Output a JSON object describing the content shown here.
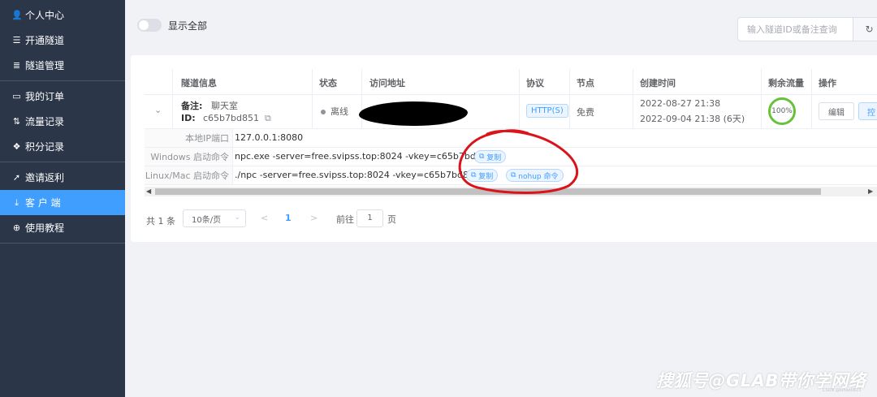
{
  "sidebar": {
    "groups": [
      [
        {
          "label": "个人中心",
          "icon": "user-icon",
          "glyph": "👤"
        },
        {
          "label": "开通隧道",
          "icon": "server-icon",
          "glyph": "☰"
        },
        {
          "label": "隧道管理",
          "icon": "list-icon",
          "glyph": "≣"
        }
      ],
      [
        {
          "label": "我的订单",
          "icon": "card-icon",
          "glyph": "▭"
        },
        {
          "label": "流量记录",
          "icon": "sort-icon",
          "glyph": "⇅"
        },
        {
          "label": "积分记录",
          "icon": "gift-icon",
          "glyph": "❖"
        }
      ],
      [
        {
          "label": "邀请返利",
          "icon": "share-icon",
          "glyph": "➚"
        },
        {
          "label": "客 户 端",
          "icon": "download-icon",
          "glyph": "⤓",
          "active": true
        },
        {
          "label": "使用教程",
          "icon": "zoom-icon",
          "glyph": "⊕"
        }
      ]
    ]
  },
  "topbar": {
    "toggle_label": "显示全部",
    "search_placeholder": "输入隧道ID或备注查询",
    "refresh_glyph": "↻"
  },
  "table": {
    "headers": [
      "隧道信息",
      "状态",
      "访问地址",
      "协议",
      "节点",
      "创建时间",
      "剩余流量",
      "操作"
    ],
    "row": {
      "expand_glyph": "⌄",
      "remark_label": "备注:",
      "remark_value": "聊天室",
      "id_label": "ID:",
      "id_value": "c65b7bd851",
      "status": "离线",
      "protocol": "HTTP(S)",
      "node": "免费",
      "created": "2022-08-27 21:38",
      "expires": "2022-09-04 21:38 (6天)",
      "traffic": "100%",
      "edit_label": "编辑",
      "control_label": "控"
    },
    "detail": {
      "local_label": "本地IP端口",
      "local_value": "127.0.0.1:8080",
      "windows_label": "Windows 启动命令",
      "windows_value": "npc.exe -server=free.svipss.top:8024 -vkey=c65b7bd851",
      "linux_label": "Linux/Mac 启动命令",
      "linux_value": "./npc -server=free.svipss.top:8024 -vkey=c65b7bd851",
      "copy_label": "复制",
      "nohup_label": "nohup 命令"
    }
  },
  "pager": {
    "total": "共 1 条",
    "page_size": "10条/页",
    "current": "1",
    "goto_label": "前往",
    "goto_value": "1",
    "page_suffix": "页",
    "prev": "<",
    "next": ">"
  },
  "watermark": "搜狐号@GLAB带你学网络",
  "watermark_small": "CSDN @lunao0623",
  "colors": {
    "primary": "#409eff",
    "sidebar": "#2b3648",
    "annotation": "#d9141b"
  }
}
